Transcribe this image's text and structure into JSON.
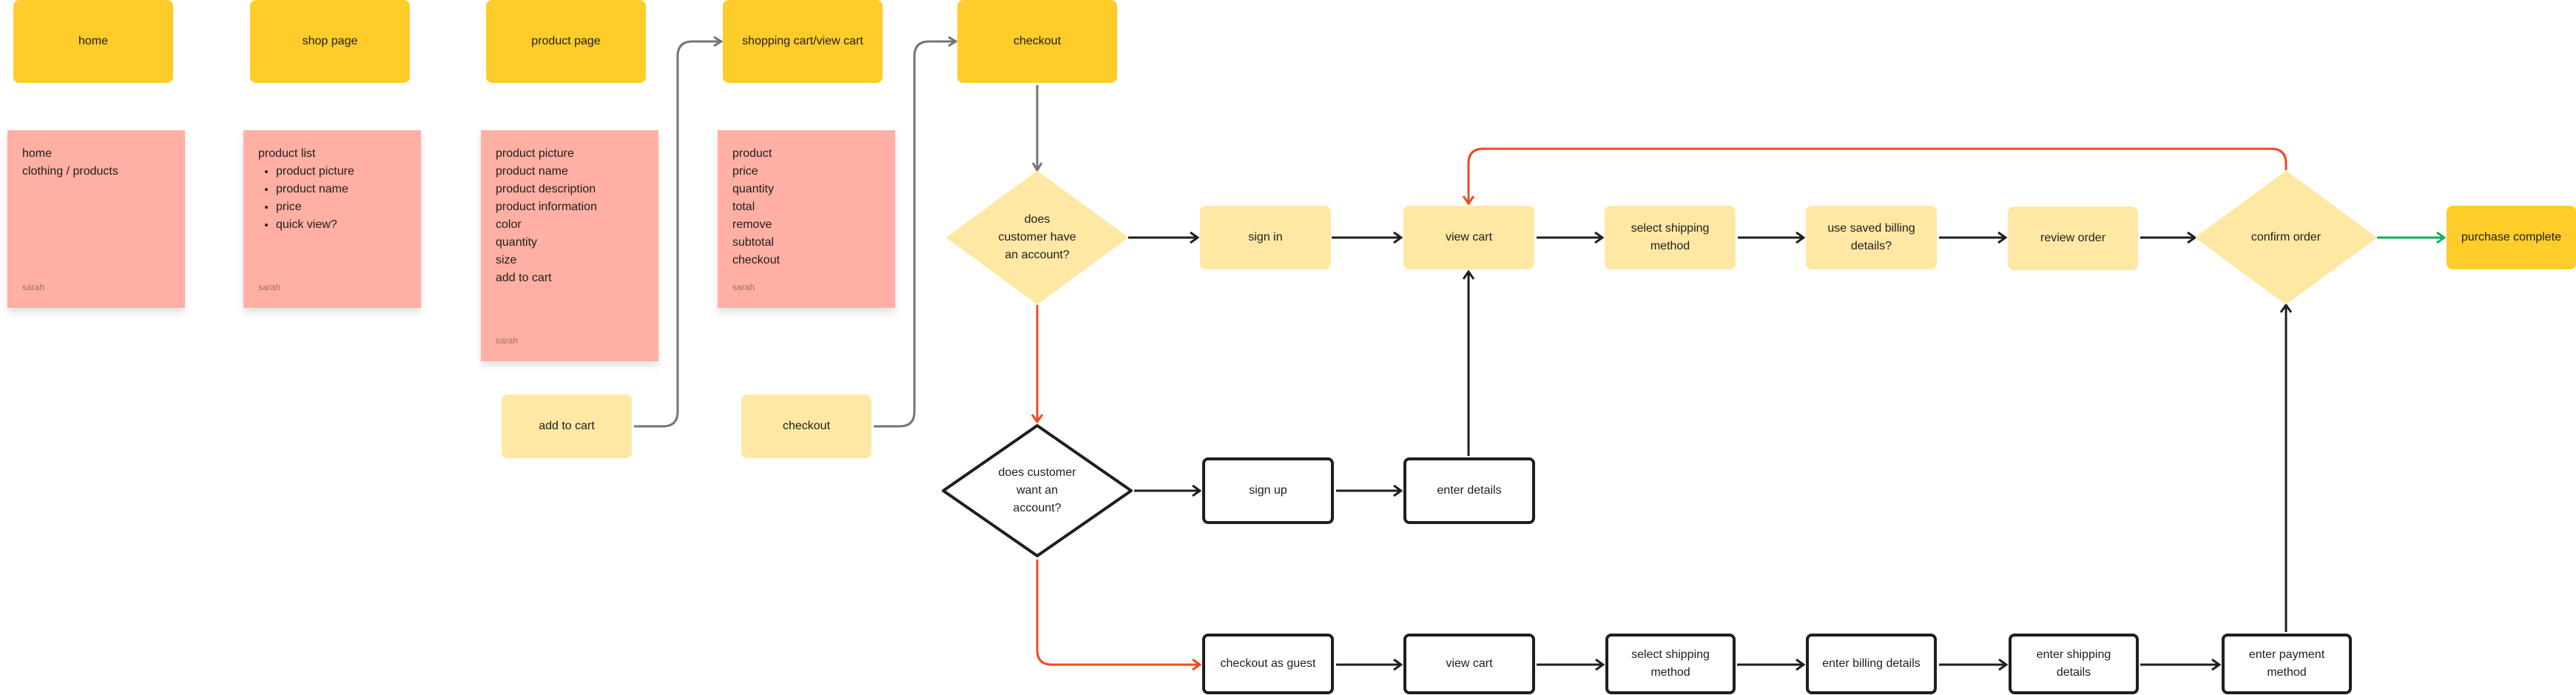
{
  "colors": {
    "page_box": "#FFCD29",
    "step_box": "#FFE8A3",
    "sticky_note": "#FFAFA3",
    "connector_gray": "#757575",
    "connector_black": "#1E1E1E",
    "connector_red": "#F24822",
    "connector_green": "#14AE5C"
  },
  "pages": [
    {
      "id": "home",
      "label": "home"
    },
    {
      "id": "shop",
      "label": "shop page"
    },
    {
      "id": "product",
      "label": "product page"
    },
    {
      "id": "cart",
      "label": "shopping cart/view cart"
    },
    {
      "id": "checkout",
      "label": "checkout"
    }
  ],
  "notes": [
    {
      "id": "home-note",
      "lines": [
        "home",
        "clothing / products"
      ],
      "author": "sarah"
    },
    {
      "id": "shop-note",
      "heading": "product list",
      "bullets": [
        "product picture",
        "product name",
        "price",
        "quick view?"
      ],
      "author": "sarah"
    },
    {
      "id": "product-note",
      "lines": [
        "product picture",
        "product name",
        "product description",
        "product information",
        "color",
        "quantity",
        "size",
        "add to cart"
      ],
      "author": "sarah"
    },
    {
      "id": "cart-note",
      "lines": [
        "product",
        "price",
        "quantity",
        "total",
        "remove",
        "subtotal",
        "checkout"
      ],
      "author": "sarah"
    }
  ],
  "actions": {
    "add_to_cart": "add to cart",
    "checkout": "checkout"
  },
  "decisions": {
    "has_account": "does\ncustomer have\nan account?",
    "wants_account": "does customer\nwant an\naccount?",
    "confirm_order": "confirm order"
  },
  "flow_signed_in": [
    "sign in",
    "view cart",
    "select shipping\nmethod",
    "use saved billing\ndetails?",
    "review order"
  ],
  "flow_signup": [
    "sign up",
    "enter details"
  ],
  "flow_guest": [
    "checkout as guest",
    "view cart",
    "select shipping\nmethod",
    "enter billing details",
    "enter shipping\ndetails",
    "enter payment\nmethod"
  ],
  "final": "purchase complete"
}
